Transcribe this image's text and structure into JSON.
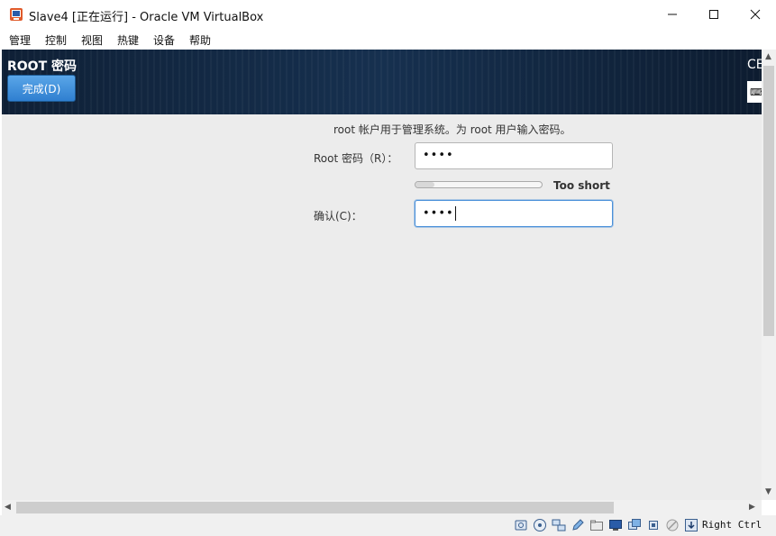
{
  "window": {
    "title": "Slave4 [正在运行] - Oracle VM VirtualBox",
    "controls": [
      "minimize",
      "maximize",
      "close"
    ]
  },
  "menubar": {
    "items": [
      {
        "label": "管理"
      },
      {
        "label": "控制"
      },
      {
        "label": "视图"
      },
      {
        "label": "热键"
      },
      {
        "label": "设备"
      },
      {
        "label": "帮助"
      }
    ]
  },
  "header": {
    "title": "ROOT 密码",
    "done_label": "完成(D)",
    "side_text": "CE",
    "keyboard_text": "⌨"
  },
  "form": {
    "description": "root 帐户用于管理系统。为 root 用户输入密码。",
    "root_password_label": "Root 密码（R）：",
    "root_password_value": "••••",
    "strength_text": "Too short",
    "strength_level": 0.15,
    "confirm_label": "确认(C)：",
    "confirm_value": "••••"
  },
  "statusbar": {
    "icons": [
      "hard-disk-icon",
      "optical-disk-icon",
      "network-icon",
      "pencil-icon",
      "shared-folder-icon",
      "display-icon",
      "vm-window-icon",
      "cpu-icon",
      "mouse-capture-icon",
      "arrow-down-icon"
    ],
    "host_key": "Right Ctrl"
  },
  "colors": {
    "banner": "#16304f",
    "done_button": "#3a8ad8",
    "focus_border": "#4a90d9"
  }
}
